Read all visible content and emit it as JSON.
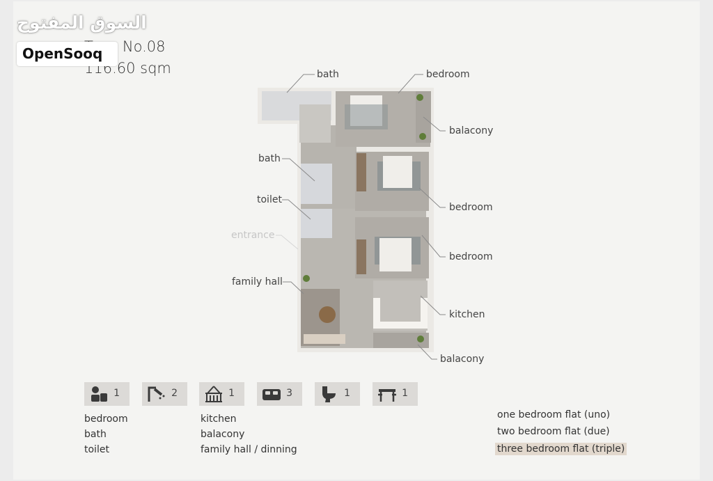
{
  "watermark": {
    "arabic": "السوق المفتوح",
    "brand": "OpenSooq"
  },
  "header": {
    "type_label": "Type No.08",
    "area_label": "116.60 sqm"
  },
  "plan_labels": {
    "bath_top": "bath",
    "bedroom_top": "bedroom",
    "balcony_top": "balacony",
    "bath_mid": "bath",
    "bedroom_mid": "bedroom",
    "toilet": "toilet",
    "entrance": "entrance",
    "bedroom_low": "bedroom",
    "family_hall": "family hall",
    "kitchen": "kitchen",
    "balcony_bottom": "balacony"
  },
  "amenities": [
    {
      "icon": "bedroom-person-icon",
      "count": "1"
    },
    {
      "icon": "shower-icon",
      "count": "2"
    },
    {
      "icon": "kitchen-icon",
      "count": "1"
    },
    {
      "icon": "bed-icon",
      "count": "3"
    },
    {
      "icon": "toilet-icon",
      "count": "1"
    },
    {
      "icon": "dining-table-icon",
      "count": "1"
    }
  ],
  "legend_left": [
    "bedroom",
    "bath",
    "toilet"
  ],
  "legend_right": [
    "kitchen",
    "balacony",
    "family hall / dinning"
  ],
  "flat_types": [
    "one bedroom flat (uno)",
    "two bedroom flat (due)",
    "three bedroom flat (triple)"
  ],
  "colors": {
    "floor": "#b9b6b1",
    "wall": "#e9e7e3",
    "tile": "#dcdad7",
    "highlight": "#e2d8cd"
  }
}
